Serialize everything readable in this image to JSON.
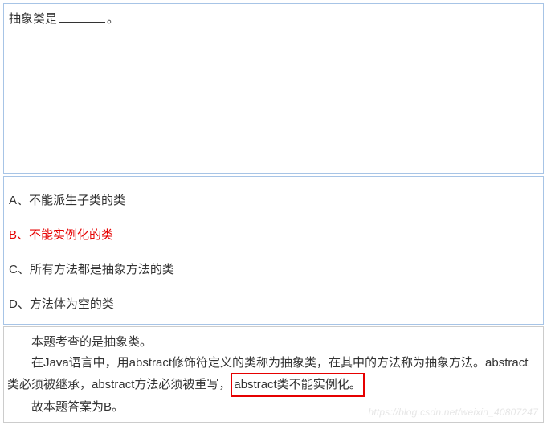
{
  "question": {
    "stem_before": "抽象类是",
    "stem_after": "。"
  },
  "options": [
    {
      "label": "A、不能派生子类的类",
      "correct": false
    },
    {
      "label": "B、不能实例化的类",
      "correct": true
    },
    {
      "label": "C、所有方法都是抽象方法的类",
      "correct": false
    },
    {
      "label": "D、方法体为空的类",
      "correct": false
    }
  ],
  "explanation": {
    "line1": "本题考查的是抽象类。",
    "line2_part1": "在Java语言中，用abstract修饰符定义的类称为抽象类，在其中的方法称为抽象方法。abstract类必须被继承，abstract方法必须被重写，",
    "key_phrase": "abstract类不能实例化。",
    "line3": "故本题答案为B。"
  },
  "watermark": "https://blog.csdn.net/weixin_40807247"
}
